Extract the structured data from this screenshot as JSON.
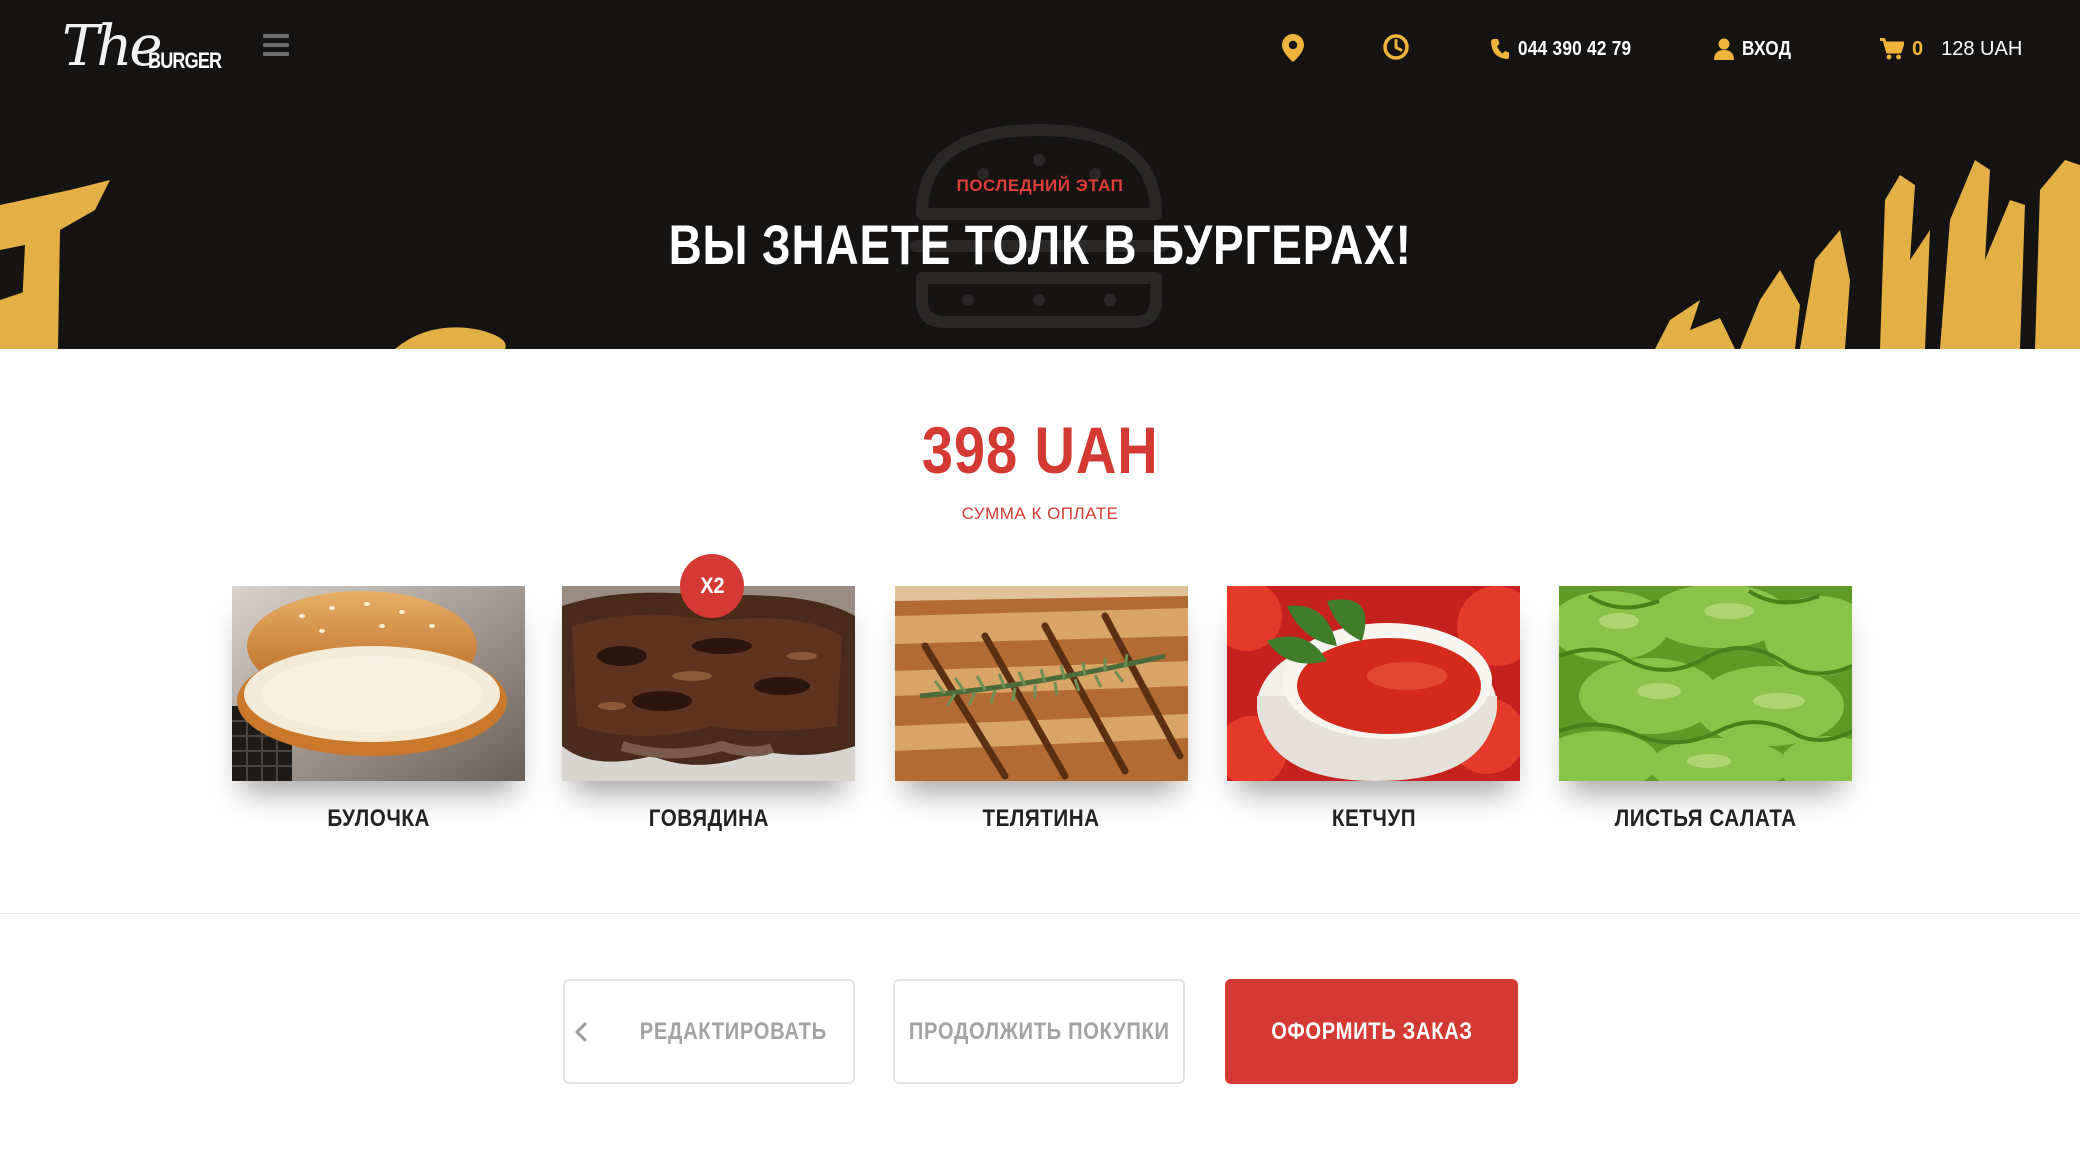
{
  "header": {
    "logo_script": "The",
    "logo_word": "BURGER",
    "phone": "044 390 42 79",
    "login_label": "ВХОД",
    "cart_count": "0",
    "cart_total": "128 UAH"
  },
  "hero": {
    "eyebrow": "ПОСЛЕДНИЙ ЭТАП",
    "title": "ВЫ ЗНАЕТЕ ТОЛК В БУРГЕРАХ!"
  },
  "summary": {
    "total": "398 UAH",
    "caption": "СУММА К ОПЛАТЕ"
  },
  "ingredients": [
    {
      "name": "БУЛОЧКА",
      "image": "bun"
    },
    {
      "name": "ГОВЯДИНА",
      "image": "beef",
      "badge": "X2"
    },
    {
      "name": "ТЕЛЯТИНА",
      "image": "veal"
    },
    {
      "name": "КЕТЧУП",
      "image": "ketchup"
    },
    {
      "name": "ЛИСТЬЯ САЛАТА",
      "image": "lettuce"
    }
  ],
  "actions": {
    "edit_label": "РЕДАКТИРОВАТЬ",
    "continue_label": "ПРОДОЛЖИТЬ ПОКУПКИ",
    "order_label": "ОФОРМИТЬ ЗАКАЗ"
  },
  "colors": {
    "accent": "#d43a33",
    "gold": "#f0b43c",
    "header_bg": "#151413"
  }
}
